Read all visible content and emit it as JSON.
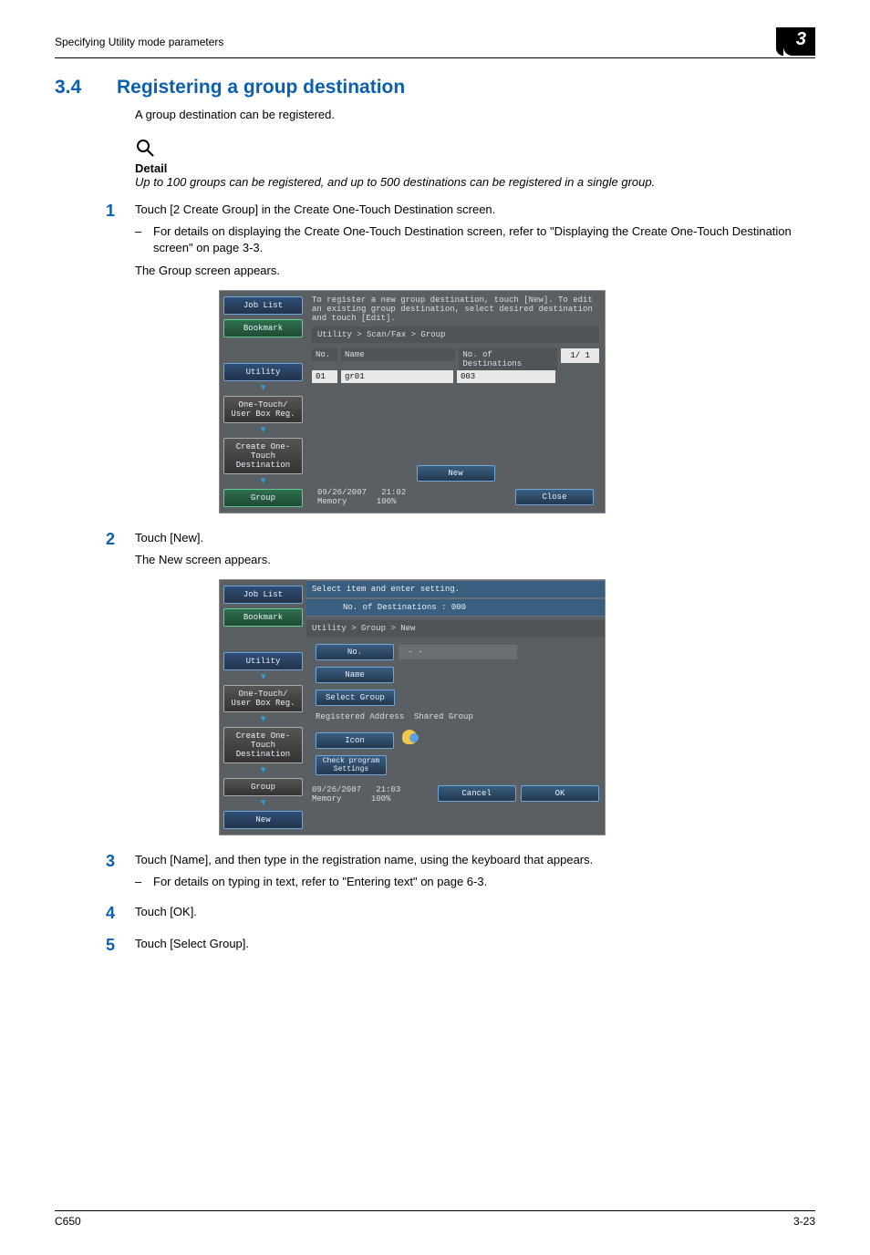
{
  "header": {
    "left": "Specifying Utility mode parameters",
    "badge": "3"
  },
  "section": {
    "num": "3.4",
    "title": "Registering a group destination",
    "intro": "A group destination can be registered."
  },
  "detail": {
    "head": "Detail",
    "text": "Up to 100 groups can be registered, and up to 500 destinations can be registered in a single group."
  },
  "steps": [
    {
      "n": "1",
      "text": "Touch [2 Create Group] in the Create One-Touch Destination screen.",
      "sub": "For details on displaying the Create One-Touch Destination screen, refer to \"Displaying the Create One-Touch Destination screen\" on page 3-3.",
      "after": "The Group screen appears."
    },
    {
      "n": "2",
      "text": "Touch [New].",
      "after": "The New screen appears."
    },
    {
      "n": "3",
      "text": "Touch [Name], and then type in the registration name, using the keyboard that appears.",
      "sub": "For details on typing in text, refer to \"Entering text\" on page 6-3."
    },
    {
      "n": "4",
      "text": "Touch [OK]."
    },
    {
      "n": "5",
      "text": "Touch [Select Group]."
    }
  ],
  "lcd1": {
    "side": {
      "jobList": "Job List",
      "bookmark": "Bookmark",
      "utility": "Utility",
      "onetouch": "One-Touch/\nUser Box Reg.",
      "create": "Create One-Touch\nDestination",
      "group": "Group"
    },
    "msg": "To register a new group destination, touch [New]. To edit an existing group destination, select desired destination and touch [Edit].",
    "crumb": "Utility > Scan/Fax > Group",
    "cols": {
      "no": "No.",
      "name": "Name",
      "dest": "No. of Destinations"
    },
    "row": {
      "no": "01",
      "name": "gr01",
      "dest": "003"
    },
    "page": "1/  1",
    "newBtn": "New",
    "date": "09/26/2007",
    "time": "21:02",
    "mem": "Memory",
    "pct": "100%",
    "close": "Close"
  },
  "lcd2": {
    "side": {
      "jobList": "Job List",
      "bookmark": "Bookmark",
      "utility": "Utility",
      "onetouch": "One-Touch/\nUser Box Reg.",
      "create": "Create One-Touch\nDestination",
      "group": "Group",
      "new": "New"
    },
    "title": "Select item and enter setting.",
    "destLine": "No. of Destinations :   000",
    "crumb": "Utility > Group > New",
    "noBtn": "No.",
    "noVal": "- -",
    "nameBtn": "Name",
    "selBtn": "Select Group",
    "regLabel": "Registered Address",
    "regVal": "Shared Group",
    "iconBtn": "Icon",
    "chkBtn": "Check program\nSettings",
    "date": "09/26/2007",
    "time": "21:03",
    "mem": "Memory",
    "pct": "100%",
    "cancel": "Cancel",
    "ok": "OK"
  },
  "footer": {
    "left": "C650",
    "right": "3-23"
  }
}
